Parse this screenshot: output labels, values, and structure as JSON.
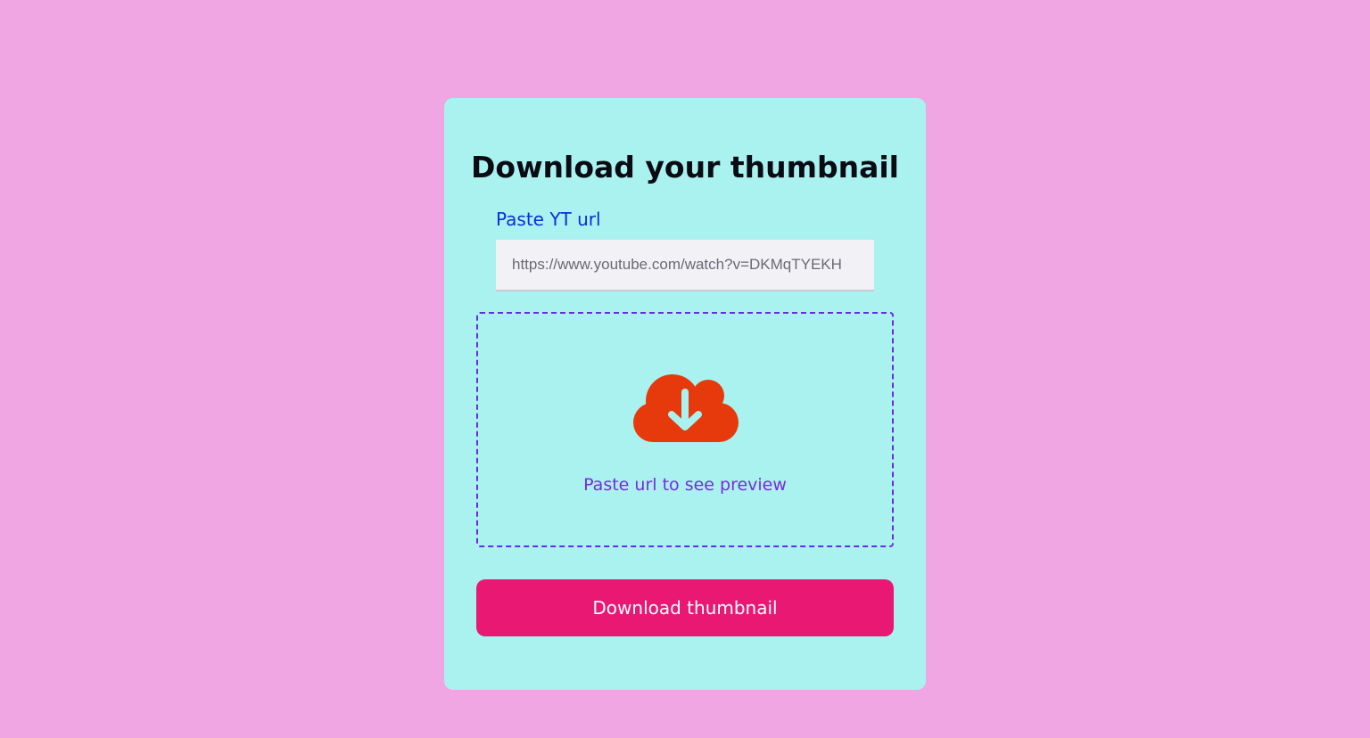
{
  "card": {
    "title": "Download your thumbnail",
    "url_label": "Paste YT url",
    "url_input": {
      "value": "https://www.youtube.com/watch?v=DKMqTYEKH",
      "placeholder": "https://www.youtube.com/watch?v=DKMqTYEKH"
    },
    "preview": {
      "icon": "cloud-download-icon",
      "message": "Paste url to see preview"
    },
    "download_button": "Download thumbnail"
  },
  "colors": {
    "page_background": "#f0a6e2",
    "card_background": "#aaf2ef",
    "label": "#0b2ed9",
    "preview_border": "#6a2ae8",
    "preview_text": "#7a2ae0",
    "icon": "#e63a0c",
    "button": "#e81873"
  }
}
